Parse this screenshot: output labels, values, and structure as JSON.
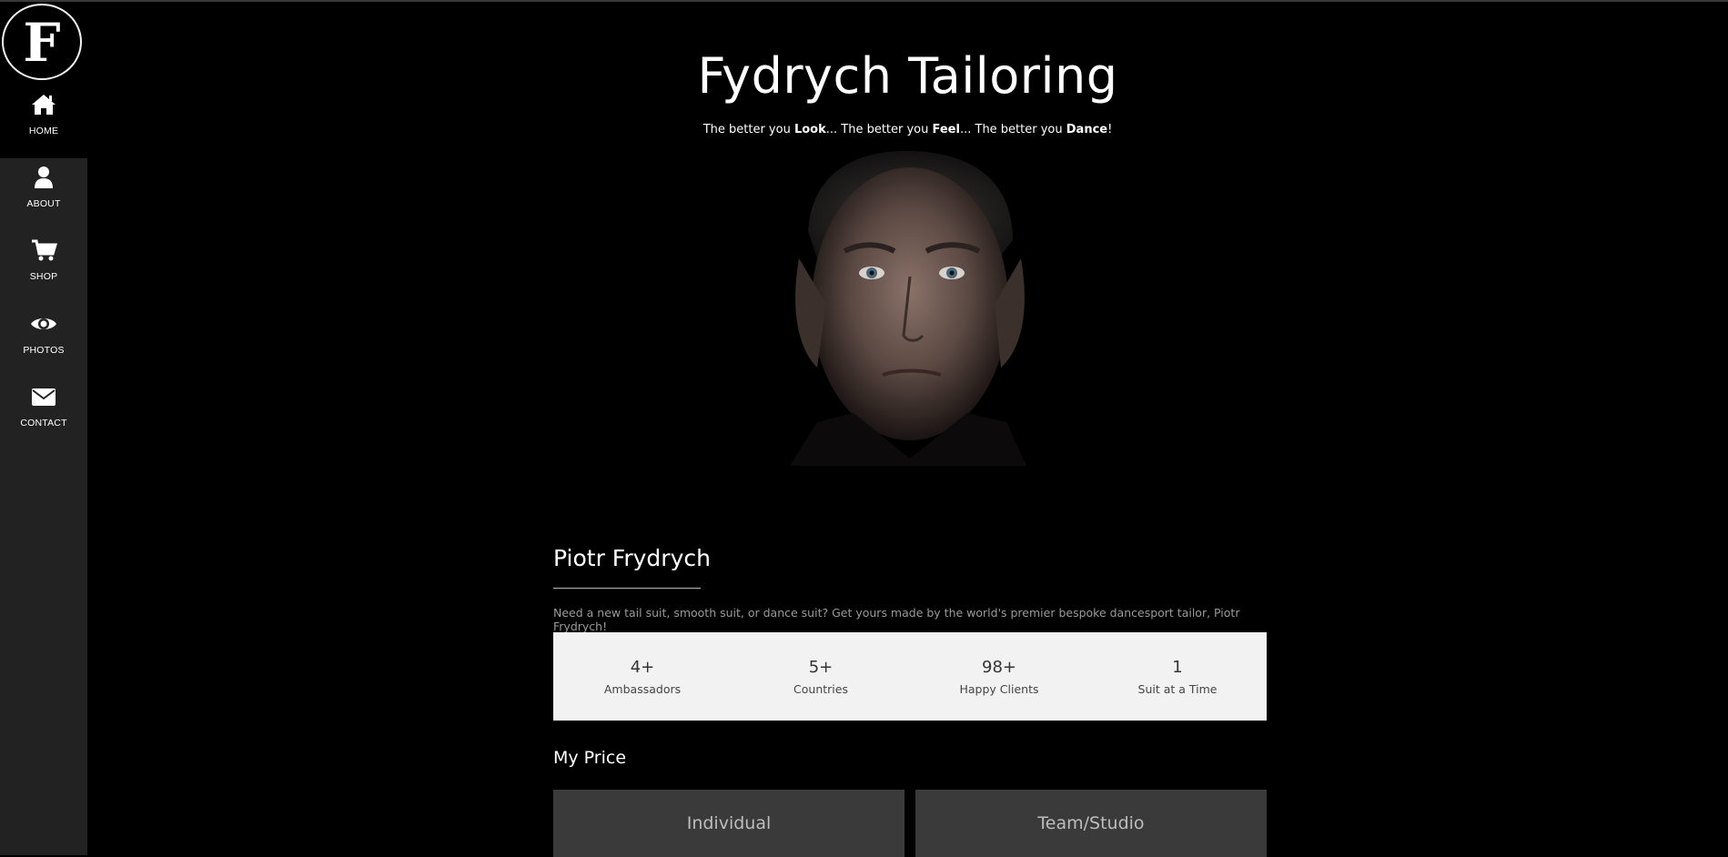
{
  "logo": {
    "letter": "F"
  },
  "sidebar": {
    "items": [
      {
        "label": "HOME",
        "icon": "home-icon"
      },
      {
        "label": "ABOUT",
        "icon": "user-icon"
      },
      {
        "label": "SHOP",
        "icon": "cart-icon"
      },
      {
        "label": "PHOTOS",
        "icon": "eye-icon"
      },
      {
        "label": "CONTACT",
        "icon": "envelope-icon"
      }
    ]
  },
  "header": {
    "title": "Fydrych Tailoring",
    "tagline": {
      "p1": "The better you ",
      "b1": "Look",
      "p2": "... The better you ",
      "b2": "Feel",
      "p3": "... The better you ",
      "b3": "Dance",
      "p4": "!"
    }
  },
  "profile": {
    "name": "Piotr Frydrych",
    "intro": "Need a new tail suit, smooth suit, or dance suit? Get yours made by the world's premier bespoke dancesport tailor, Piotr Frydrych!"
  },
  "stats": [
    {
      "value": "4+",
      "label": "Ambassadors"
    },
    {
      "value": "5+",
      "label": "Countries"
    },
    {
      "value": "98+",
      "label": "Happy Clients"
    },
    {
      "value": "1",
      "label": "Suit at a Time"
    }
  ],
  "pricing": {
    "title": "My Price",
    "cards": [
      {
        "label": "Individual"
      },
      {
        "label": "Team/Studio"
      }
    ]
  },
  "colors": {
    "sidebar_bg": "#222222",
    "page_bg": "#000000",
    "stats_bg": "#f2f2f2",
    "card_bg": "#3a3a3a"
  }
}
